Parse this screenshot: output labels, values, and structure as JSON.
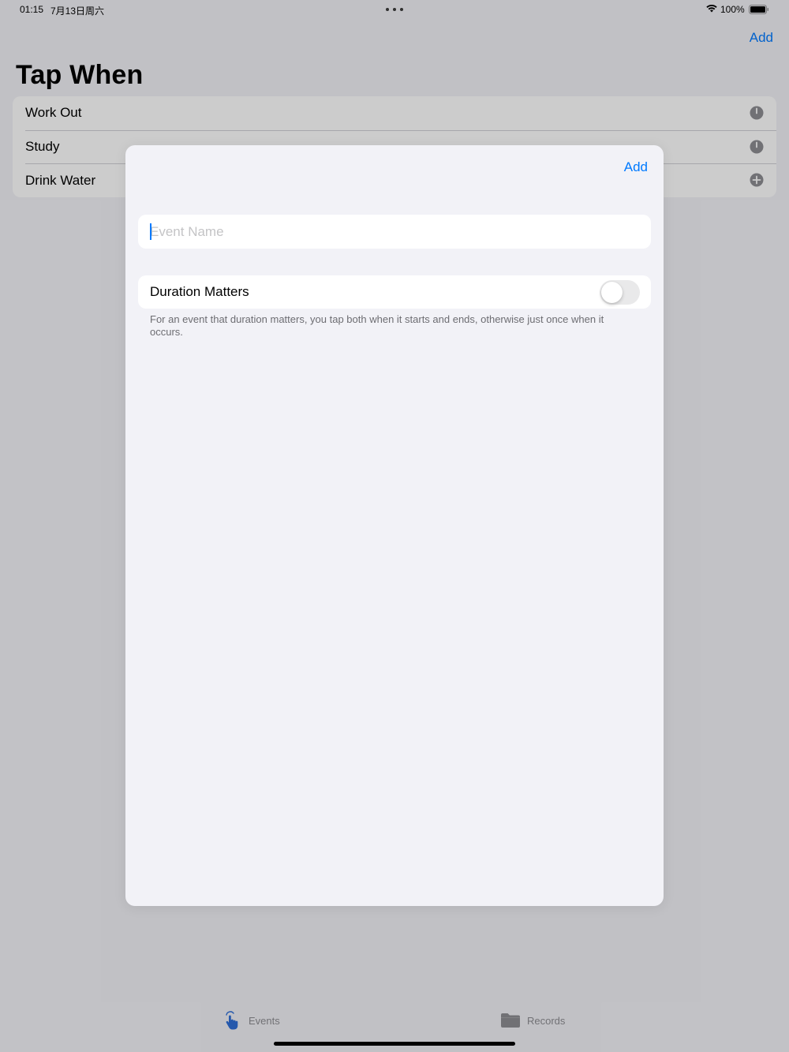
{
  "status_bar": {
    "time": "01:15",
    "date": "7月13日周六",
    "battery_percent": "100%",
    "icons": [
      "more-dots-icon",
      "wifi-icon",
      "battery-icon"
    ]
  },
  "nav": {
    "add_label": "Add",
    "title": "Tap When"
  },
  "events": [
    {
      "name": "Work Out",
      "icon": "timer-icon"
    },
    {
      "name": "Study",
      "icon": "timer-icon"
    },
    {
      "name": "Drink Water",
      "icon": "plus-circle-icon"
    }
  ],
  "sheet": {
    "add_label": "Add",
    "event_name": {
      "value": "",
      "placeholder": "Event Name"
    },
    "duration": {
      "label": "Duration Matters",
      "enabled": false,
      "footer": "For an event that duration matters, you tap both when it starts and ends, otherwise just once when it occurs."
    }
  },
  "tabs": [
    {
      "label": "Events",
      "icon": "tap-hand-icon"
    },
    {
      "label": "Records",
      "icon": "folder-icon"
    }
  ],
  "colors": {
    "accent": "#007aff",
    "background": "#f2f2f7",
    "secondary_text": "#8e8e93"
  }
}
